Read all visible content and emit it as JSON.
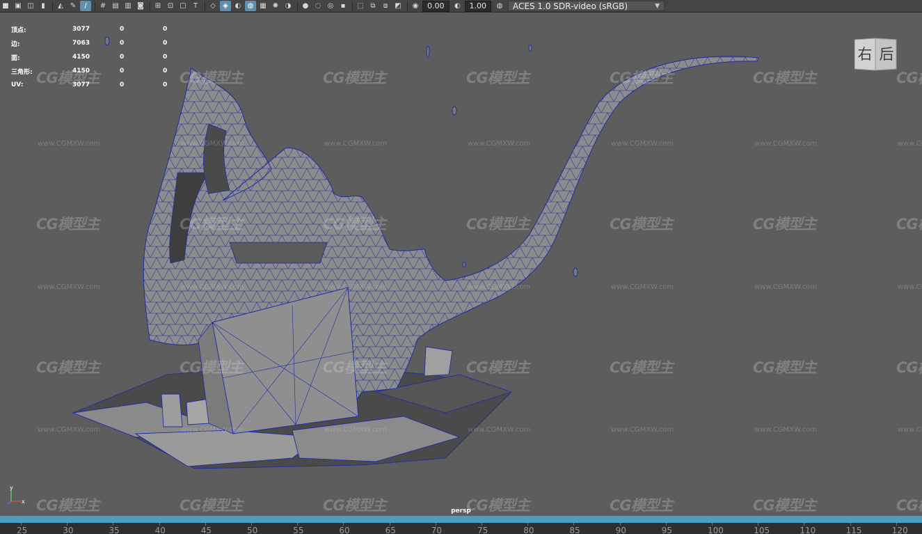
{
  "toolbar": {
    "exposure": "0.00",
    "gamma": "1.00",
    "color_management": "ACES 1.0 SDR-video (sRGB)"
  },
  "hud": {
    "rows": [
      {
        "label": "顶点:",
        "v1": "3077",
        "v2": "0",
        "v3": "0"
      },
      {
        "label": "边:",
        "v1": "7063",
        "v2": "0",
        "v3": "0"
      },
      {
        "label": "面:",
        "v1": "4150",
        "v2": "0",
        "v3": "0"
      },
      {
        "label": "三角形:",
        "v1": "4150",
        "v2": "0",
        "v3": "0"
      },
      {
        "label": "UV:",
        "v1": "3077",
        "v2": "0",
        "v3": "0"
      }
    ]
  },
  "viewcube": {
    "right_face": "右",
    "back_face": "后"
  },
  "watermark": {
    "logo": "CG模型主",
    "url": "www.CGMXW.com"
  },
  "axis": {
    "y_label": "y",
    "x_label": "x"
  },
  "camera_label": "persp",
  "timeline": {
    "ticks": [
      "25",
      "30",
      "35",
      "40",
      "45",
      "50",
      "55",
      "60",
      "65",
      "70",
      "75",
      "80",
      "85",
      "90",
      "95",
      "100",
      "105",
      "110",
      "115",
      "120"
    ]
  },
  "colors": {
    "viewport_bg": "#5d5d5d",
    "wireframe": "#1d2ea6",
    "mesh_fill": "#8e8e8e",
    "timeline_slider": "#4b9ec4"
  }
}
